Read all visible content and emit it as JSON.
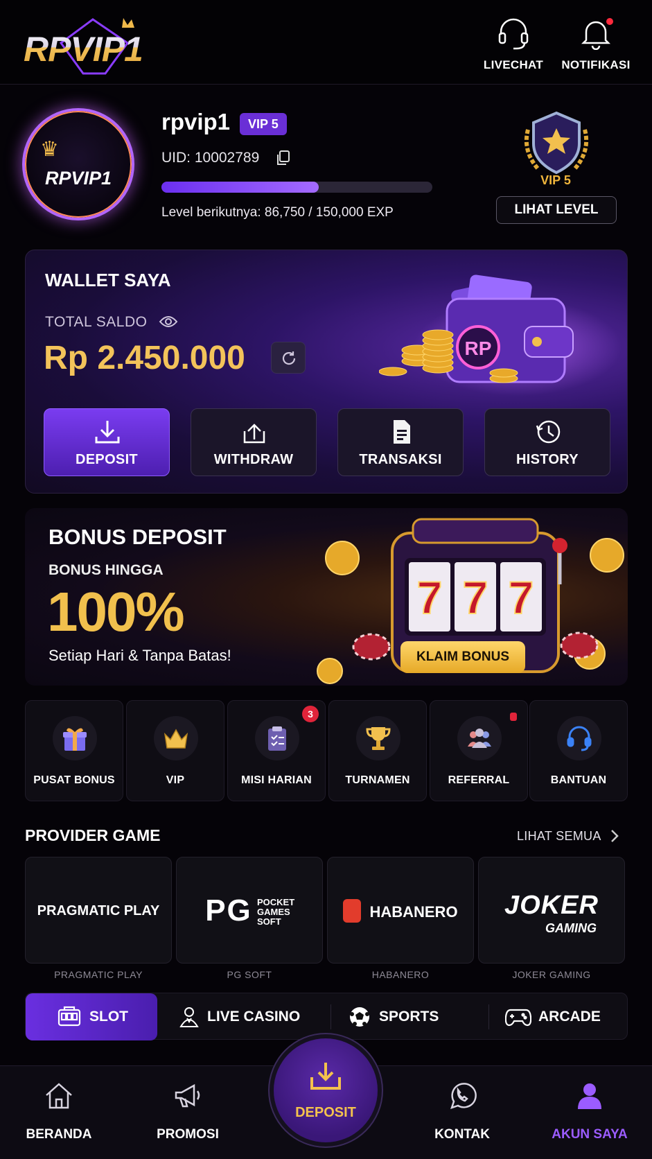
{
  "header": {
    "logo_text": "RPVIP1",
    "livechat_label": "LIVECHAT",
    "notif_label": "NOTIFIKASI"
  },
  "profile": {
    "avatar_text": "RPVIP1",
    "username": "rpvip1",
    "vip_badge": "VIP 5",
    "uid": "UID: 10002789",
    "exp_progress": 0.58,
    "exp_text": "Level berikutnya: 86,750 / 150,000 EXP",
    "vip_level_text": "VIP 5",
    "lihat_level_label": "LIHAT LEVEL"
  },
  "wallet": {
    "title": "WALLET SAYA",
    "saldo_label": "TOTAL SALDO",
    "saldo_value": "Rp 2.450.000",
    "art_text": "RP",
    "actions": [
      {
        "label": "DEPOSIT",
        "icon": "download-icon"
      },
      {
        "label": "WITHDRAW",
        "icon": "upload-icon"
      },
      {
        "label": "TRANSAKSI",
        "icon": "document-icon"
      },
      {
        "label": "HISTORY",
        "icon": "history-icon"
      }
    ]
  },
  "banner": {
    "title": "BONUS DEPOSIT",
    "subtitle": "BONUS HINGGA",
    "big": "100%",
    "note": "Setiap Hari & Tanpa Batas!",
    "cta": "KLAIM BONUS",
    "reel_text": "7"
  },
  "quick_menu": [
    {
      "label": "PUSAT BONUS",
      "icon": "gift-icon"
    },
    {
      "label": "VIP",
      "icon": "crown-icon"
    },
    {
      "label": "MISI HARIAN",
      "icon": "clipboard-icon",
      "badge": "3"
    },
    {
      "label": "TURNAMEN",
      "icon": "trophy-icon"
    },
    {
      "label": "REFERRAL",
      "icon": "people-icon"
    },
    {
      "label": "BANTUAN",
      "icon": "headset-icon"
    }
  ],
  "providers": {
    "title": "PROVIDER GAME",
    "see_all": "LIHAT SEMUA",
    "items": [
      {
        "logo": "PRAGMATIC PLAY",
        "name": "PRAGMATIC PLAY"
      },
      {
        "logo": "PG",
        "logo_sub": "POCKET GAMES SOFT",
        "name": "PG SOFT"
      },
      {
        "logo": "HABANERO",
        "name": "HABANERO"
      },
      {
        "logo": "JOKER",
        "logo_sub": "GAMING",
        "name": "JOKER GAMING"
      }
    ]
  },
  "categories": [
    {
      "label": "SLOT",
      "icon": "slot-icon"
    },
    {
      "label": "LIVE CASINO",
      "icon": "dealer-icon"
    },
    {
      "label": "SPORTS",
      "icon": "soccer-icon"
    },
    {
      "label": "ARCADE",
      "icon": "gamepad-icon"
    }
  ],
  "bottom_nav": {
    "home": "BERANDA",
    "promo": "PROMOSI",
    "deposit": "DEPOSIT",
    "contact": "KONTAK",
    "account": "AKUN SAYA"
  },
  "colors": {
    "accent_purple": "#6a2fd6",
    "gold": "#f3c35a",
    "active_nav": "#9b5cff",
    "badge_red": "#e0243a"
  }
}
